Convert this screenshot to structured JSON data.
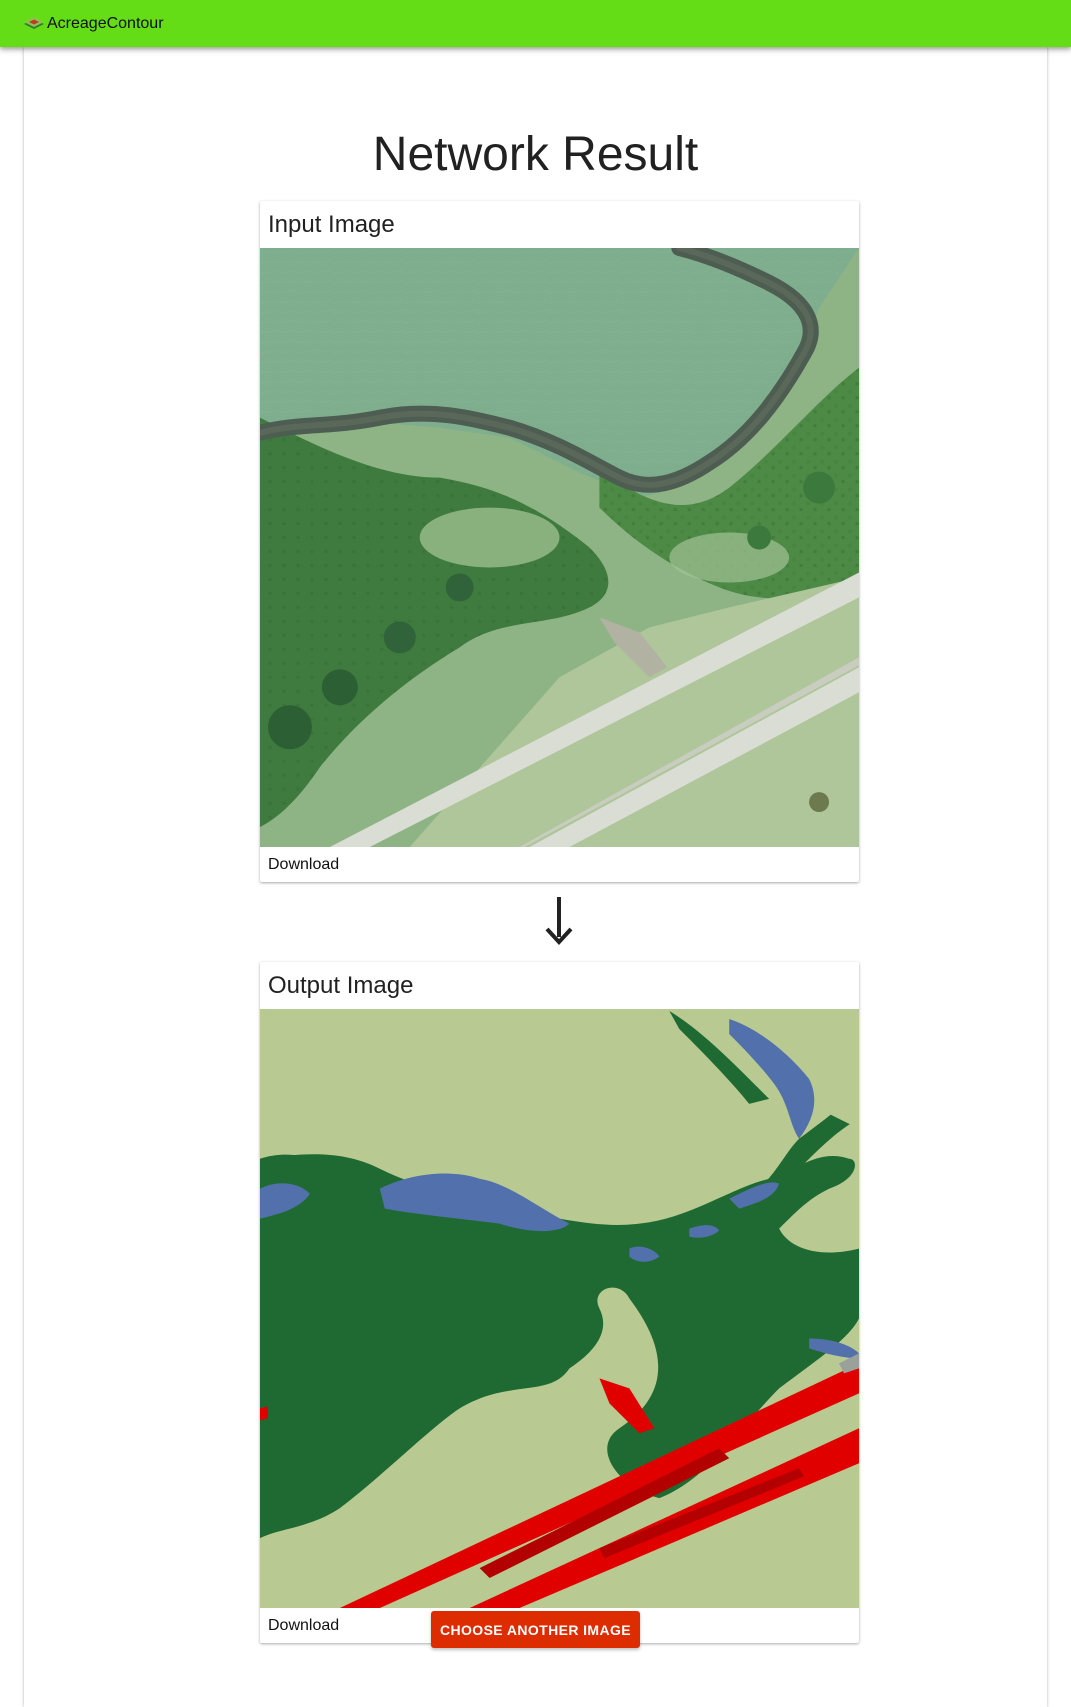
{
  "app": {
    "brand_name": "AcreageContour",
    "logo_icon": "layers-logo-icon",
    "accent_color": "#64dd17",
    "button_color": "#dd2c00"
  },
  "main": {
    "title": "Network Result",
    "input_card": {
      "title": "Input Image",
      "action_label": "Download"
    },
    "output_card": {
      "title": "Output Image",
      "action_label": "Download"
    },
    "arrow_icon": "arrow-down-icon",
    "choose_button_label": "CHOOSE ANOTHER IMAGE"
  }
}
